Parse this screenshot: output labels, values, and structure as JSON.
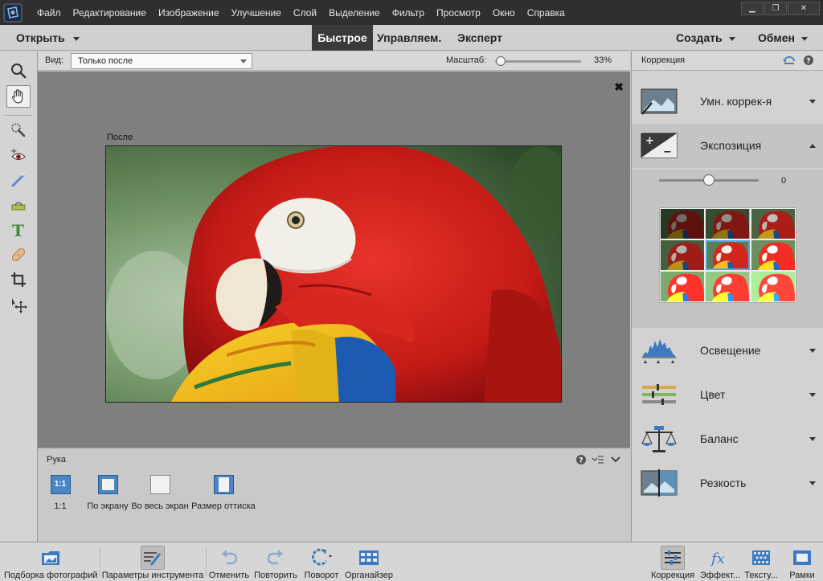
{
  "menubar": {
    "items": [
      "Файл",
      "Редактирование",
      "Изображение",
      "Улучшение",
      "Слой",
      "Выделение",
      "Фильтр",
      "Просмотр",
      "Окно",
      "Справка"
    ],
    "window_controls": [
      "minimize-icon",
      "restore-icon",
      "close-icon"
    ]
  },
  "modebar": {
    "open_label": "Открыть",
    "tabs": [
      "Быстрое",
      "Управляем.",
      "Эксперт"
    ],
    "active_tab": "Быстрое",
    "create_label": "Создать",
    "share_label": "Обмен"
  },
  "toolbar": {
    "tools": [
      "zoom-icon",
      "hand-icon",
      "quick-selection-icon",
      "red-eye-icon",
      "whiten-teeth-icon",
      "straighten-icon",
      "type-icon",
      "spot-healing-icon",
      "crop-icon",
      "move-icon"
    ],
    "active_tool": "hand-icon"
  },
  "options_bar": {
    "view_label": "Вид:",
    "view_value": "Только после",
    "zoom_label": "Масштаб:",
    "zoom_value": "33%",
    "zoom_level": 0.07
  },
  "canvas": {
    "after_label": "После",
    "close_glyph": "✖"
  },
  "tool_options": {
    "title": "Рука",
    "buttons": [
      {
        "badge": "1:1",
        "label": "1:1"
      },
      {
        "label": "По экрану"
      },
      {
        "label": "Во весь экран"
      },
      {
        "label": "Размер оттиска"
      }
    ]
  },
  "right_panel": {
    "title": "Коррекция",
    "sections": [
      {
        "label": "Умн. коррек-я",
        "expanded": false
      },
      {
        "label": "Экспозиция",
        "expanded": true
      },
      {
        "label": "Освещение",
        "expanded": false
      },
      {
        "label": "Цвет",
        "expanded": false
      },
      {
        "label": "Баланс",
        "expanded": false
      },
      {
        "label": "Резкость",
        "expanded": false
      }
    ],
    "exposure": {
      "slider_value": "0",
      "slider_level": 0.5,
      "selected_thumb": 4
    }
  },
  "bottom_bar": {
    "left": [
      "Подборка фотографий",
      "Параметры инструмента",
      "Отменить",
      "Повторить",
      "Поворот",
      "Органайзер"
    ],
    "right": [
      "Коррекция",
      "Эффект...",
      "Тексту...",
      "Рамки"
    ],
    "active_left": "Параметры инструмента",
    "active_right": "Коррекция"
  },
  "colors": {
    "menubar_bg": "#2f2f2f",
    "active_tab_bg": "#3a3a3a",
    "accent_blue": "#4a86c5",
    "selection_outline": "#5aa0d8"
  }
}
